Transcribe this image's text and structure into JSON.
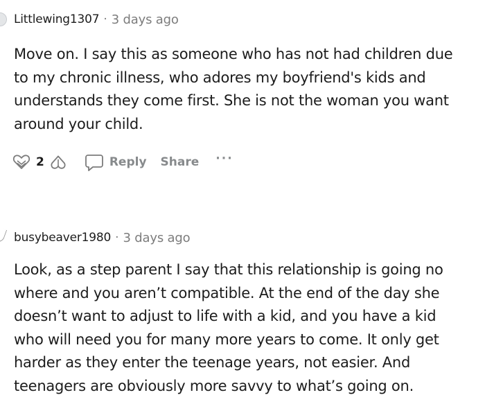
{
  "comments": [
    {
      "username": "Littlewing1307",
      "separator": "·",
      "time": "3 days ago",
      "lines": [
        "Move on. I say this as someone who has not had children due",
        "to my chronic illness, who adores my boyfriend's kids and",
        "understands they come first. She is not the woman you want",
        "around your child."
      ],
      "votes": "2",
      "reply_label": "Reply",
      "share_label": "Share",
      "more_label": "···"
    },
    {
      "username": "busybeaver1980",
      "separator": "·",
      "time": "3 days ago",
      "lines": [
        "Look, as a step parent I say that this relationship is going no",
        "where and you aren’t compatible. At the end of the day she",
        "doesn’t want to adjust to life with a kid, and you have a kid",
        "who will need you for many more years to come. It only get",
        "harder as they enter the teenage years, not easier. And",
        "teenagers are obviously more savvy to what’s going on."
      ]
    }
  ],
  "icons": {
    "upvote": "heart-upvote-icon",
    "downvote": "heart-downvote-icon",
    "reply": "speech-bubble-icon",
    "more": "more-options-icon"
  },
  "colors": {
    "text": "#1c1c1c",
    "muted": "#7c7c7c",
    "action": "#878a8c"
  }
}
